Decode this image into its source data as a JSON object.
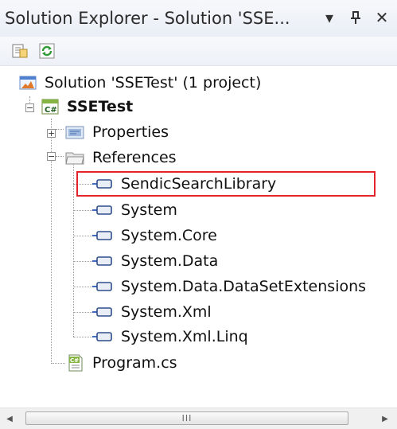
{
  "window": {
    "title": "Solution Explorer - Solution 'SSE...",
    "dropdown_glyph": "▾",
    "pin_glyph": "ᚋ",
    "close_glyph": "✕"
  },
  "toolbar": {
    "buttons": [
      {
        "icon": "properties-icon"
      },
      {
        "icon": "refresh-icon"
      }
    ]
  },
  "tree": {
    "solution": {
      "label": "Solution 'SSETest' (1 project)",
      "icon": "solution-icon"
    },
    "project": {
      "label": "SSETest",
      "icon": "csharp-project-icon"
    },
    "properties": {
      "label": "Properties",
      "icon": "properties-folder-icon"
    },
    "references": {
      "label": "References",
      "icon": "references-folder-icon"
    },
    "reference_items": [
      {
        "label": "SendicSearchLibrary",
        "highlighted": true
      },
      {
        "label": "System"
      },
      {
        "label": "System.Core"
      },
      {
        "label": "System.Data"
      },
      {
        "label": "System.Data.DataSetExtensions"
      },
      {
        "label": "System.Xml"
      },
      {
        "label": "System.Xml.Linq"
      }
    ],
    "program": {
      "label": "Program.cs",
      "icon": "csharp-file-icon"
    }
  },
  "scrollbar": {
    "thumb_text": "III"
  },
  "colors": {
    "highlight_border": "#e3252b"
  }
}
